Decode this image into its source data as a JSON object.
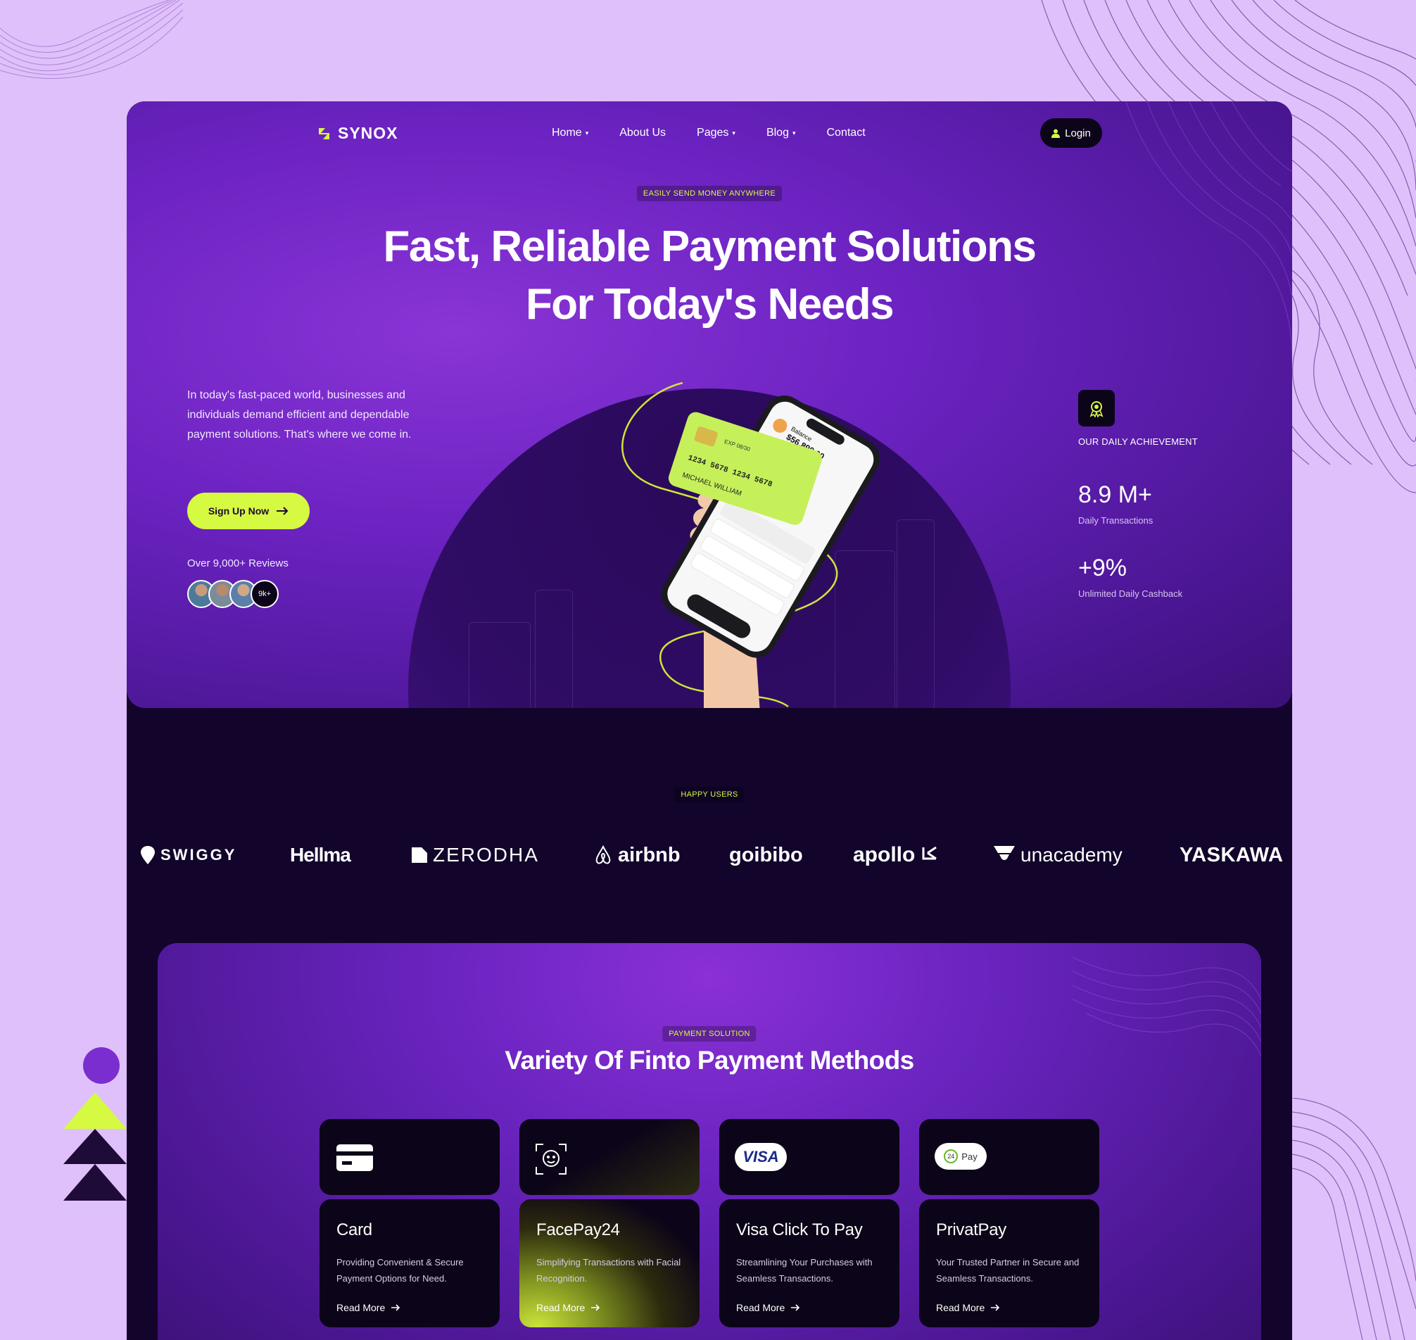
{
  "nav": {
    "logo": "SYNOX",
    "links": [
      {
        "label": "Home",
        "caret": "▾"
      },
      {
        "label": "About Us",
        "caret": ""
      },
      {
        "label": "Pages",
        "caret": "▾"
      },
      {
        "label": "Blog",
        "caret": "▾"
      },
      {
        "label": "Contact",
        "caret": ""
      }
    ],
    "login": "Login"
  },
  "hero": {
    "eyebrow": "EASILY SEND MONEY ANYWHERE",
    "title_line1": "Fast, Reliable Payment Solutions",
    "title_line2": "For Today's Needs",
    "description": "In today's fast-paced world, businesses and individuals demand  efficient and dependable payment solutions. That's where we come in.",
    "cta": "Sign Up Now",
    "reviews_label": "Over 9,000+ Reviews",
    "reviews_more": "9k+"
  },
  "stats": {
    "label": "OUR DAILY ACHIEVEMENT",
    "items": [
      {
        "value": "8.9 M+",
        "caption": "Daily Transactions"
      },
      {
        "value": "+9%",
        "caption": "Unlimited Daily Cashback"
      }
    ]
  },
  "phone": {
    "balance": "$56,890.00",
    "card_number": "1234  5678  1234  5678",
    "card_holder": "MICHAEL WILLIAM",
    "card_exp": "EXP 08/30"
  },
  "happy_users": {
    "eyebrow": "HAPPY USERS",
    "brands": [
      "SWIGGY",
      "Hellma",
      "ZERODHA",
      "airbnb",
      "goibibo",
      "apollo",
      "unacademy",
      "YASKAWA"
    ]
  },
  "payments": {
    "eyebrow": "PAYMENT SOLUTION",
    "title": "Variety Of Finto Payment Methods",
    "cards": [
      {
        "title": "Card",
        "desc": " Providing Convenient & Secure Payment Options for Need.",
        "more": "Read More"
      },
      {
        "title": "FacePay24",
        "desc": "Simplifying Transactions with Facial Recognition.",
        "more": "Read More"
      },
      {
        "title": "Visa Click To Pay",
        "desc": "Streamlining Your Purchases with Seamless Transactions.",
        "more": "Read More"
      },
      {
        "title": "PrivatPay",
        "desc": "Your Trusted Partner in Secure and Seamless Transactions.",
        "more": "Read More"
      }
    ],
    "visa_badge": "VISA",
    "privat_badge": "Pay",
    "privat_num": "24"
  },
  "colors": {
    "accent": "#d6f942",
    "purple": "#7a2ed0",
    "dark": "#12042b",
    "page_bg": "#e0c0fa"
  }
}
